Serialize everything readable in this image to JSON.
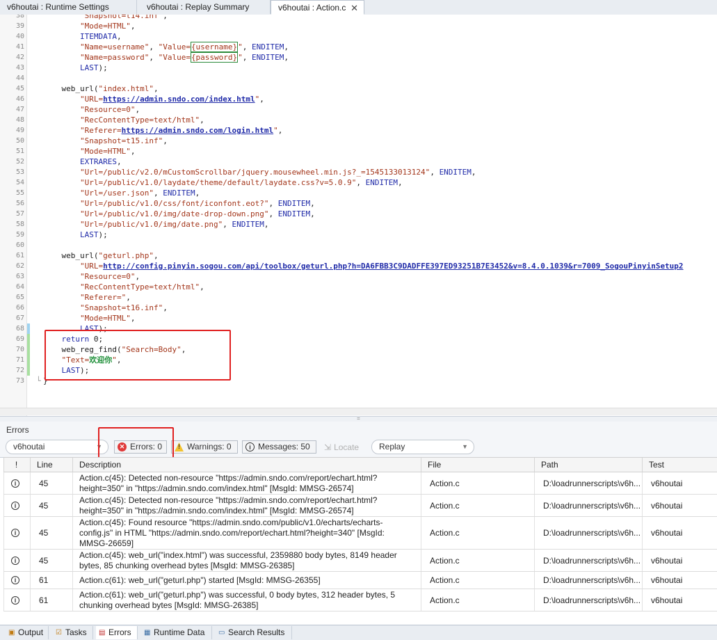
{
  "tabs": [
    {
      "label": "v6houtai : Runtime Settings"
    },
    {
      "label": "v6houtai : Replay Summary"
    },
    {
      "label": "v6houtai : Action.c"
    }
  ],
  "close_glyph": "✕",
  "code_lines": [
    {
      "n": "38",
      "t": "        \"Snapshot=t14.inf\","
    },
    {
      "n": "39",
      "t": "        \"Mode=HTML\","
    },
    {
      "n": "40",
      "t": "        ITEMDATA,"
    },
    {
      "n": "41",
      "t": "        \"Name=username\", \"Value={username}\", ENDITEM,"
    },
    {
      "n": "42",
      "t": "        \"Name=password\", \"Value={password}\", ENDITEM,"
    },
    {
      "n": "43",
      "t": "        LAST);"
    },
    {
      "n": "44",
      "t": ""
    },
    {
      "n": "45",
      "t": "    web_url(\"index.html\","
    },
    {
      "n": "46",
      "t": "        \"URL=https://admin.sndo.com/index.html\","
    },
    {
      "n": "47",
      "t": "        \"Resource=0\","
    },
    {
      "n": "48",
      "t": "        \"RecContentType=text/html\","
    },
    {
      "n": "49",
      "t": "        \"Referer=https://admin.sndo.com/login.html\","
    },
    {
      "n": "50",
      "t": "        \"Snapshot=t15.inf\","
    },
    {
      "n": "51",
      "t": "        \"Mode=HTML\","
    },
    {
      "n": "52",
      "t": "        EXTRARES,"
    },
    {
      "n": "53",
      "t": "        \"Url=/public/v2.0/mCustomScrollbar/jquery.mousewheel.min.js?_=1545133013124\", ENDITEM,"
    },
    {
      "n": "54",
      "t": "        \"Url=/public/v1.0/laydate/theme/default/laydate.css?v=5.0.9\", ENDITEM,"
    },
    {
      "n": "55",
      "t": "        \"Url=/user.json\", ENDITEM,"
    },
    {
      "n": "56",
      "t": "        \"Url=/public/v1.0/css/font/iconfont.eot?\", ENDITEM,"
    },
    {
      "n": "57",
      "t": "        \"Url=/public/v1.0/img/date-drop-down.png\", ENDITEM,"
    },
    {
      "n": "58",
      "t": "        \"Url=/public/v1.0/img/date.png\", ENDITEM,"
    },
    {
      "n": "59",
      "t": "        LAST);"
    },
    {
      "n": "60",
      "t": ""
    },
    {
      "n": "61",
      "t": "    web_url(\"geturl.php\","
    },
    {
      "n": "62",
      "t": "        \"URL=http://config.pinyin.sogou.com/api/toolbox/geturl.php?h=DA6FBB3C9DADFFE397ED93251B7E3452&v=8.4.0.1039&r=7009_SogouPinyinSetup2"
    },
    {
      "n": "63",
      "t": "        \"Resource=0\","
    },
    {
      "n": "64",
      "t": "        \"RecContentType=text/html\","
    },
    {
      "n": "65",
      "t": "        \"Referer=\","
    },
    {
      "n": "66",
      "t": "        \"Snapshot=t16.inf\","
    },
    {
      "n": "67",
      "t": "        \"Mode=HTML\","
    },
    {
      "n": "68",
      "t": "        LAST);"
    },
    {
      "n": "69",
      "t": "    return 0;"
    },
    {
      "n": "70",
      "t": "    web_reg_find(\"Search=Body\","
    },
    {
      "n": "71",
      "t": "    \"Text=欢迎你\","
    },
    {
      "n": "72",
      "t": "    LAST);"
    },
    {
      "n": "73",
      "t": "}"
    }
  ],
  "errors_panel": {
    "title": "Errors",
    "script_combo": "v6houtai",
    "errors_btn": "Errors: 0",
    "warnings_btn": "Warnings: 0",
    "messages_btn": "Messages: 50",
    "locate_btn": "Locate",
    "replay_combo": "Replay",
    "columns": [
      "!",
      "Line",
      "Description",
      "File",
      "Path",
      "Test"
    ],
    "rows": [
      {
        "line": "45",
        "desc": "Action.c(45): Detected non-resource \"https://admin.sndo.com/report/echart.html?height=350\" in \"https://admin.sndo.com/index.html\"    [MsgId: MMSG-26574]",
        "file": "Action.c",
        "path": "D:\\loadrunnerscripts\\v6h...",
        "test": "v6houtai"
      },
      {
        "line": "45",
        "desc": "Action.c(45): Detected non-resource \"https://admin.sndo.com/report/echart.html?height=350\" in \"https://admin.sndo.com/index.html\"    [MsgId: MMSG-26574]",
        "file": "Action.c",
        "path": "D:\\loadrunnerscripts\\v6h...",
        "test": "v6houtai"
      },
      {
        "line": "45",
        "desc": "Action.c(45): Found resource \"https://admin.sndo.com/public/v1.0/echarts/echarts-config.js\" in HTML \"https://admin.sndo.com/report/echart.html?height=340\"        [MsgId: MMSG-26659]",
        "file": "Action.c",
        "path": "D:\\loadrunnerscripts\\v6h...",
        "test": "v6houtai"
      },
      {
        "line": "45",
        "desc": "Action.c(45): web_url(\"index.html\") was successful, 2359880 body bytes, 8149 header bytes, 85 chunking overhead bytes                [MsgId: MMSG-26385]",
        "file": "Action.c",
        "path": "D:\\loadrunnerscripts\\v6h...",
        "test": "v6houtai"
      },
      {
        "line": "61",
        "desc": "Action.c(61): web_url(\"geturl.php\") started    [MsgId: MMSG-26355]",
        "file": "Action.c",
        "path": "D:\\loadrunnerscripts\\v6h...",
        "test": "v6houtai"
      },
      {
        "line": "61",
        "desc": "Action.c(61): web_url(\"geturl.php\") was successful, 0 body bytes, 312 header bytes, 5 chunking overhead bytes   [MsgId: MMSG-26385]",
        "file": "Action.c",
        "path": "D:\\loadrunnerscripts\\v6h...",
        "test": "v6houtai"
      }
    ]
  },
  "bottom_tabs": [
    {
      "label": "Output",
      "icon": "output-icon"
    },
    {
      "label": "Tasks",
      "icon": "tasks-icon"
    },
    {
      "label": "Errors",
      "icon": "errors-icon"
    },
    {
      "label": "Runtime Data",
      "icon": "runtime-data-icon"
    },
    {
      "label": "Search Results",
      "icon": "search-results-icon"
    }
  ],
  "colors": {
    "highlight_box": "#e02020",
    "string": "#a3361b",
    "keyword": "#1f2aa8",
    "url": "#1f2aa8"
  }
}
